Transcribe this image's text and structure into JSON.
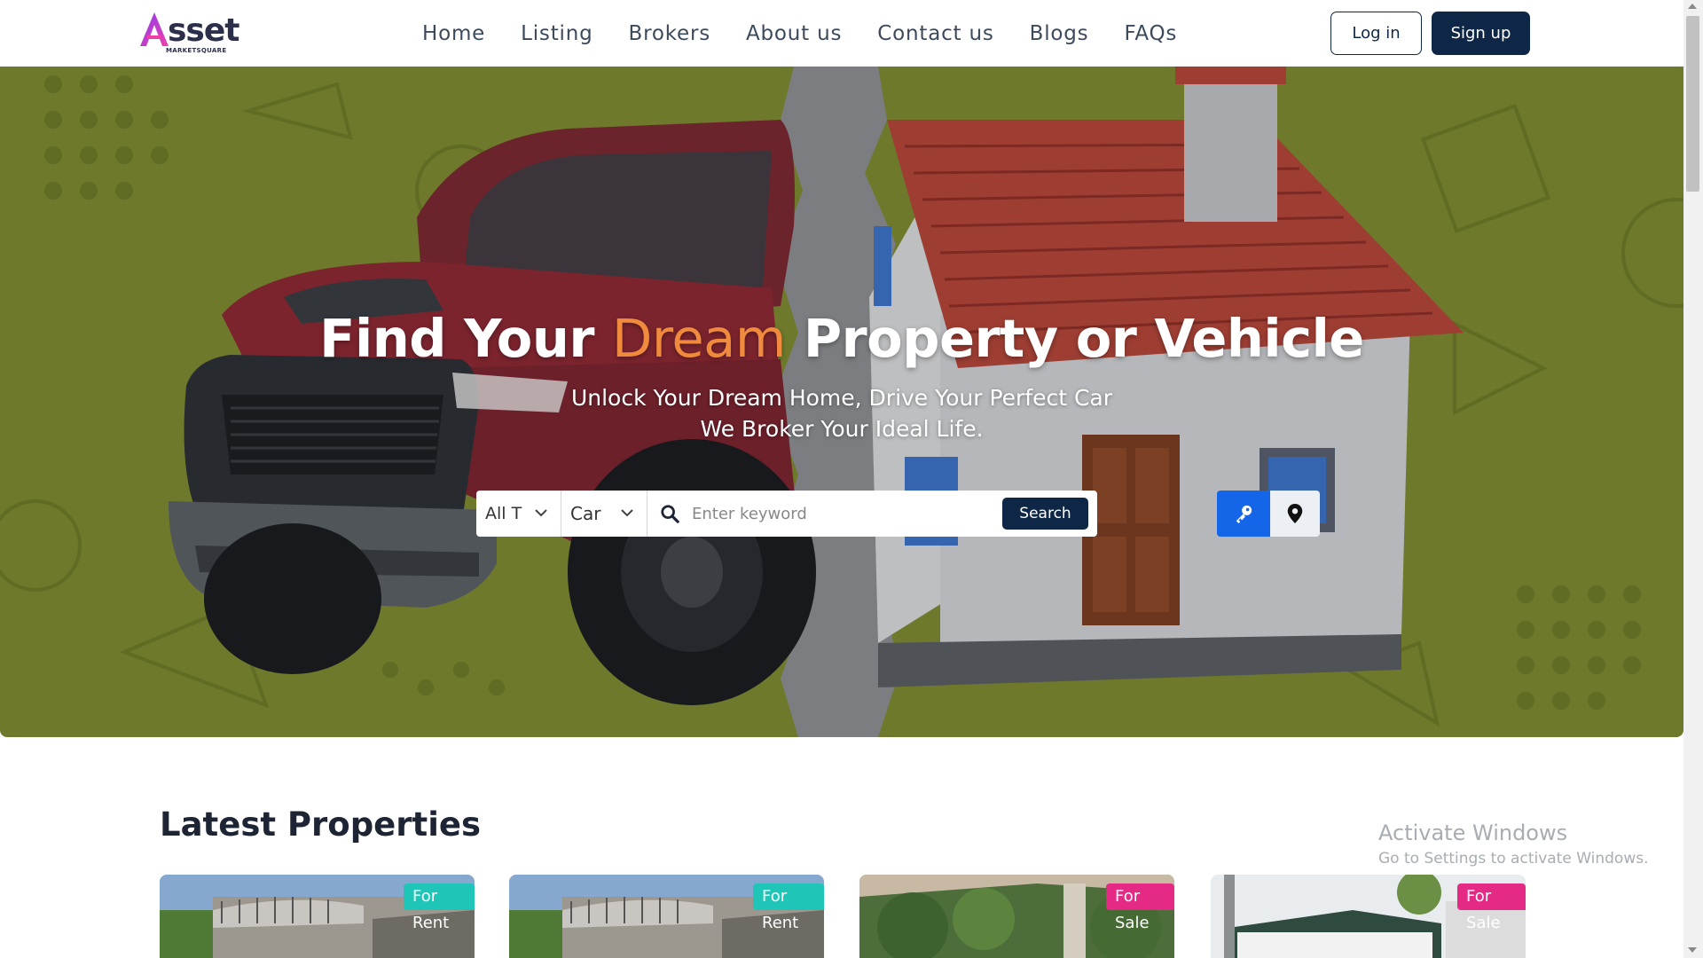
{
  "brand": {
    "logo_letter": "A",
    "logo_text": "sset",
    "logo_sub": "MARKETSQUARE"
  },
  "nav": {
    "items": [
      "Home",
      "Listing",
      "Brokers",
      "About us",
      "Contact us",
      "Blogs",
      "FAQs"
    ],
    "login_label": "Log in",
    "signup_label": "Sign up"
  },
  "hero": {
    "title_part1": "Find Your ",
    "title_accent": "Dream",
    "title_part2": " Property or Vehicle",
    "subtitle_line1": "Unlock Your Dream Home, Drive Your Perfect Car",
    "subtitle_line2": "We Broker Your Ideal Life."
  },
  "search": {
    "filter_type": "All T",
    "filter_category": "Car",
    "placeholder": "Enter keyword",
    "button_label": "Search"
  },
  "latest": {
    "title": "Latest Properties",
    "cards": [
      {
        "tag": "For Rent"
      },
      {
        "tag": "For Rent"
      },
      {
        "tag": "For Sale"
      },
      {
        "tag": "For Sale"
      }
    ]
  },
  "watermark": {
    "title": "Activate Windows",
    "subtitle": "Go to Settings to activate Windows."
  },
  "colors": {
    "primary": "#0f2747",
    "accent": "#f08a3c",
    "hero_bg": "#7e8a33",
    "rent_tag": "#1fc6b7",
    "sale_tag": "#e52a86",
    "key_button": "#1565e8"
  },
  "icons": {
    "key": "key-icon",
    "pin": "map-pin-icon",
    "search": "search-icon",
    "chevron": "chevron-down-icon"
  }
}
